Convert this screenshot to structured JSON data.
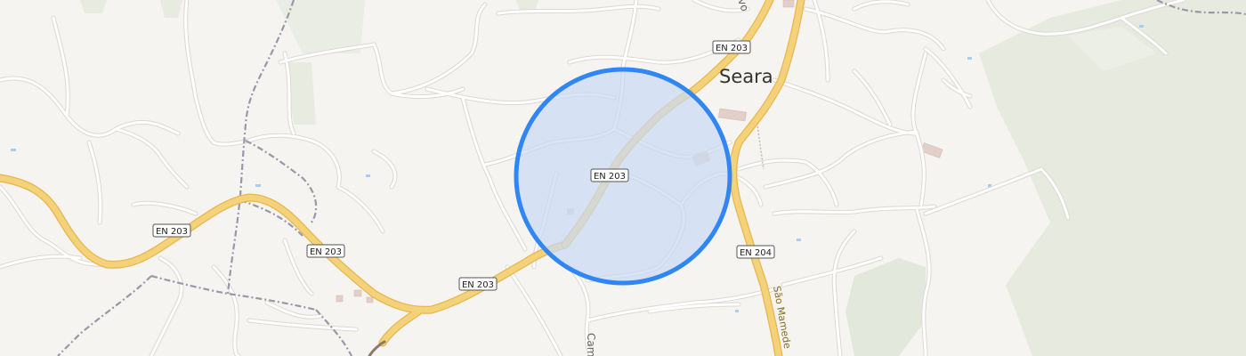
{
  "map": {
    "town_label": "Seara",
    "road_shields": [
      {
        "id": "en203-a",
        "text": "EN 203"
      },
      {
        "id": "en203-b",
        "text": "EN 203"
      },
      {
        "id": "en203-c",
        "text": "EN 203"
      },
      {
        "id": "en203-d",
        "text": "EN 203"
      },
      {
        "id": "en203-e",
        "text": "EN 203"
      },
      {
        "id": "en204",
        "text": "EN 204"
      }
    ],
    "street_labels": {
      "rua_sao_mamede": "São Mamede",
      "caminho_partial": "Cam",
      "top_partial": "vo"
    },
    "colors": {
      "background": "#f6f4f1",
      "main_road": "#f4d27a",
      "main_road_casing": "#e8b64e",
      "minor_road": "#ffffff",
      "minor_road_casing": "#dcd8d2",
      "border": "#9a97a8",
      "woodland": "#e6eadf",
      "water": "#a9cdf0",
      "selection_fill": "#c9daf4",
      "selection_stroke": "#2f86f4"
    }
  }
}
